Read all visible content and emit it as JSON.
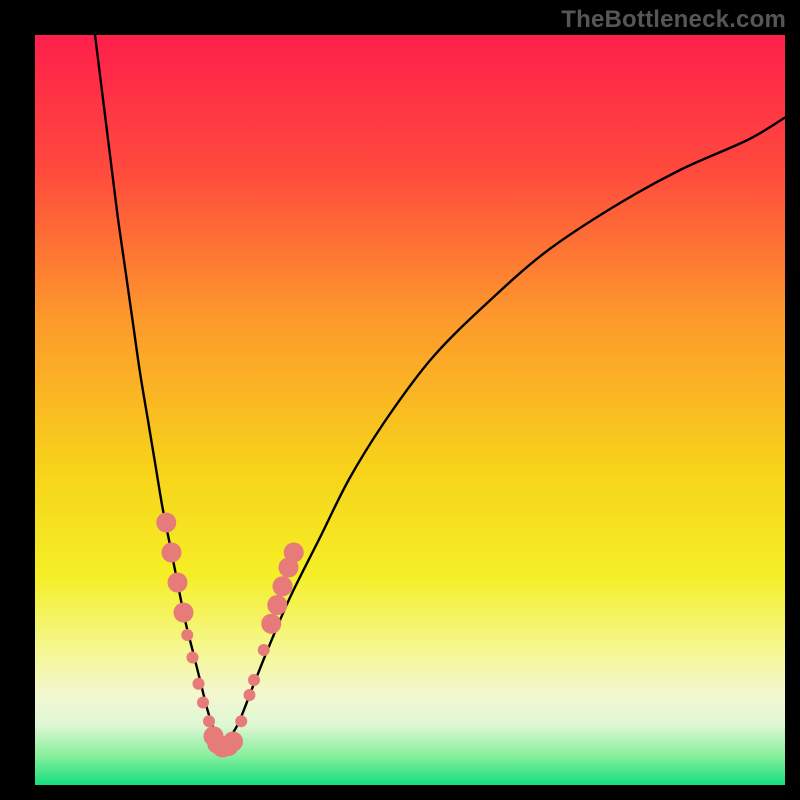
{
  "watermark": "TheBottleneck.com",
  "chart_data": {
    "type": "line",
    "title": "",
    "xlabel": "",
    "ylabel": "",
    "xlim": [
      0,
      100
    ],
    "ylim": [
      0,
      100
    ],
    "grid": false,
    "legend": false,
    "gradient_stops": [
      {
        "offset": 0.0,
        "color": "#ff1f4b"
      },
      {
        "offset": 0.18,
        "color": "#ff4a3d"
      },
      {
        "offset": 0.38,
        "color": "#fd9a2c"
      },
      {
        "offset": 0.58,
        "color": "#f7d31a"
      },
      {
        "offset": 0.72,
        "color": "#f5ef26"
      },
      {
        "offset": 0.82,
        "color": "#f5f791"
      },
      {
        "offset": 0.88,
        "color": "#f3f7d0"
      },
      {
        "offset": 0.92,
        "color": "#dff7d4"
      },
      {
        "offset": 0.96,
        "color": "#8aef9d"
      },
      {
        "offset": 1.0,
        "color": "#14df7e"
      }
    ],
    "series": [
      {
        "name": "left-curve",
        "color": "#000000",
        "width": 2.4,
        "x": [
          8,
          9,
          10,
          11,
          12,
          13,
          14,
          15,
          16,
          17,
          18,
          19,
          20,
          21,
          22,
          23,
          24,
          25
        ],
        "y": [
          100,
          92,
          84,
          76,
          69,
          62,
          55,
          49,
          43,
          37,
          32,
          27,
          22,
          18,
          14,
          10,
          7,
          5
        ]
      },
      {
        "name": "right-curve",
        "color": "#000000",
        "width": 2.4,
        "x": [
          25,
          27,
          29,
          31,
          34,
          38,
          42,
          47,
          53,
          60,
          68,
          77,
          86,
          95,
          100
        ],
        "y": [
          5,
          8,
          13,
          18,
          25,
          33,
          41,
          49,
          57,
          64,
          71,
          77,
          82,
          86,
          89
        ]
      }
    ],
    "markers": {
      "name": "bottleneck-markers",
      "color": "#e77b7a",
      "radius_small": 6,
      "radius_large": 10,
      "points": [
        {
          "x": 17.5,
          "y": 35.0,
          "r": "large"
        },
        {
          "x": 18.2,
          "y": 31.0,
          "r": "large"
        },
        {
          "x": 19.0,
          "y": 27.0,
          "r": "large"
        },
        {
          "x": 19.8,
          "y": 23.0,
          "r": "large"
        },
        {
          "x": 20.3,
          "y": 20.0,
          "r": "small"
        },
        {
          "x": 21.0,
          "y": 17.0,
          "r": "small"
        },
        {
          "x": 21.8,
          "y": 13.5,
          "r": "small"
        },
        {
          "x": 22.4,
          "y": 11.0,
          "r": "small"
        },
        {
          "x": 23.2,
          "y": 8.5,
          "r": "small"
        },
        {
          "x": 23.8,
          "y": 6.5,
          "r": "large"
        },
        {
          "x": 24.3,
          "y": 5.5,
          "r": "large"
        },
        {
          "x": 25.0,
          "y": 5.0,
          "r": "large"
        },
        {
          "x": 25.8,
          "y": 5.2,
          "r": "large"
        },
        {
          "x": 26.4,
          "y": 5.8,
          "r": "large"
        },
        {
          "x": 27.5,
          "y": 8.5,
          "r": "small"
        },
        {
          "x": 28.6,
          "y": 12.0,
          "r": "small"
        },
        {
          "x": 29.2,
          "y": 14.0,
          "r": "small"
        },
        {
          "x": 30.5,
          "y": 18.0,
          "r": "small"
        },
        {
          "x": 31.5,
          "y": 21.5,
          "r": "large"
        },
        {
          "x": 32.3,
          "y": 24.0,
          "r": "large"
        },
        {
          "x": 33.0,
          "y": 26.5,
          "r": "large"
        },
        {
          "x": 33.8,
          "y": 29.0,
          "r": "large"
        },
        {
          "x": 34.5,
          "y": 31.0,
          "r": "large"
        }
      ]
    }
  }
}
